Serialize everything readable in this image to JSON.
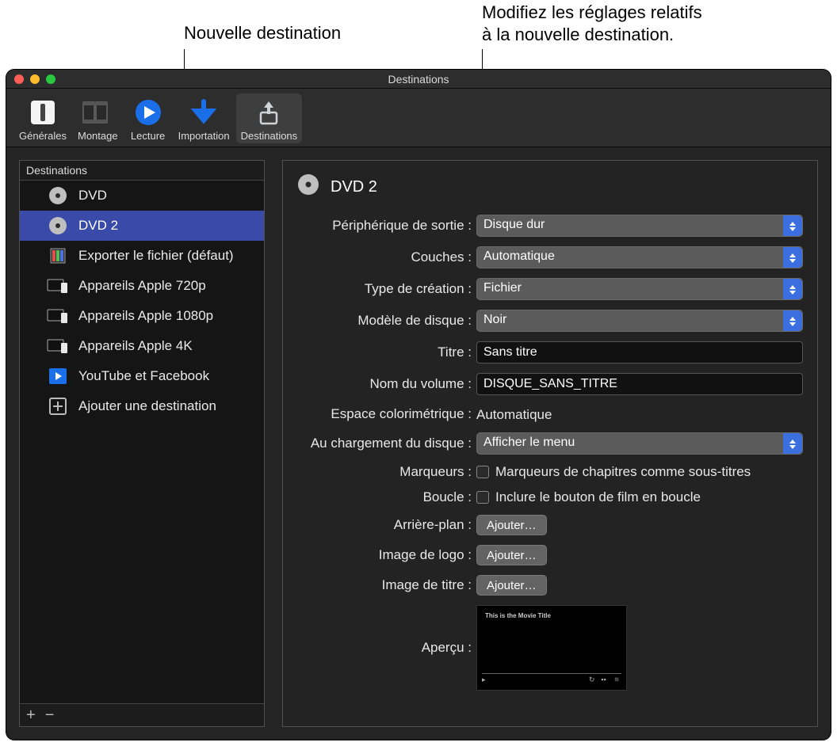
{
  "callouts": {
    "left": "Nouvelle destination",
    "right_line1": "Modifiez les réglages relatifs",
    "right_line2": "à la nouvelle destination."
  },
  "window": {
    "title": "Destinations"
  },
  "toolbar": {
    "items": [
      {
        "label": "Générales"
      },
      {
        "label": "Montage"
      },
      {
        "label": "Lecture"
      },
      {
        "label": "Importation"
      },
      {
        "label": "Destinations"
      }
    ]
  },
  "sidebar": {
    "header": "Destinations",
    "items": [
      {
        "label": "DVD"
      },
      {
        "label": "DVD 2"
      },
      {
        "label": "Exporter le fichier (défaut)"
      },
      {
        "label": "Appareils Apple 720p"
      },
      {
        "label": "Appareils Apple 1080p"
      },
      {
        "label": "Appareils Apple 4K"
      },
      {
        "label": "YouTube et Facebook"
      },
      {
        "label": "Ajouter une destination"
      }
    ]
  },
  "settings": {
    "title": "DVD 2",
    "rows": {
      "output_device": {
        "label": "Périphérique de sortie :",
        "value": "Disque dur"
      },
      "layers": {
        "label": "Couches :",
        "value": "Automatique"
      },
      "build_type": {
        "label": "Type de création :",
        "value": "Fichier"
      },
      "disc_template": {
        "label": "Modèle de disque :",
        "value": "Noir"
      },
      "title": {
        "label": "Titre :",
        "value": "Sans titre"
      },
      "volume_name": {
        "label": "Nom du volume :",
        "value": "DISQUE_SANS_TITRE"
      },
      "color_space": {
        "label": "Espace colorimétrique :",
        "value": "Automatique"
      },
      "on_disc_load": {
        "label": "Au chargement du disque :",
        "value": "Afficher le menu"
      },
      "markers": {
        "label": "Marqueurs :",
        "checkbox": "Marqueurs de chapitres comme sous-titres"
      },
      "loop": {
        "label": "Boucle :",
        "checkbox": "Inclure le bouton de film en boucle"
      },
      "background": {
        "label": "Arrière-plan :",
        "button": "Ajouter…"
      },
      "logo_image": {
        "label": "Image de logo :",
        "button": "Ajouter…"
      },
      "title_image": {
        "label": "Image de titre :",
        "button": "Ajouter…"
      },
      "preview": {
        "label": "Aperçu :",
        "preview_caption": "This is the Movie Title"
      }
    }
  }
}
